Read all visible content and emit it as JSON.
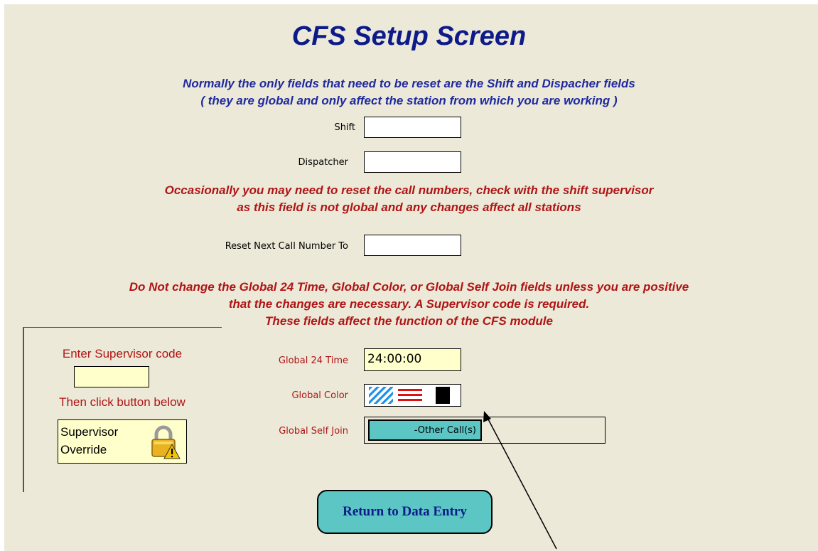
{
  "title": "CFS Setup Screen",
  "notes": {
    "normal_line1": "Normally the only fields that need to be reset are the Shift and Dispacher fields",
    "normal_line2": "( they are global and only affect the station from which you are working )",
    "occasional_line1": "Occasionally you may need to reset the call numbers, check with the shift supervisor",
    "occasional_line2": "as this field is not global and any changes affect all stations",
    "donot_line1": "Do Not change the Global 24 Time, Global Color, or Global Self Join fields unless you are positive",
    "donot_line2": "that the changes are necessary. A Supervisor code is required.",
    "donot_line3": "These fields affect the function of the CFS module"
  },
  "fields": {
    "shift_label": "Shift",
    "shift_value": "",
    "dispatcher_label": "Dispatcher",
    "dispatcher_value": "",
    "reset_label": "Reset Next Call Number To",
    "reset_value": "",
    "global24_label": "Global 24 Time",
    "global24_value": "24:00:00",
    "globalcolor_label": "Global Color",
    "selfjoin_label": "Global Self Join",
    "selfjoin_button": "-Other Call(s)"
  },
  "supervisor": {
    "enter_label": "Enter Supervisor code",
    "code_value": "",
    "then_label": "Then click button below",
    "override_label": "Supervisor\nOverride"
  },
  "return_button": "Return to Data Entry",
  "colors": {
    "title": "#0d1a8a",
    "warning": "#b01414",
    "button_teal": "#5bc6c4",
    "field_yellow": "#ffffcc"
  },
  "icons": {
    "lock": "lock-warning-icon",
    "arrow": "pointer-arrow"
  }
}
